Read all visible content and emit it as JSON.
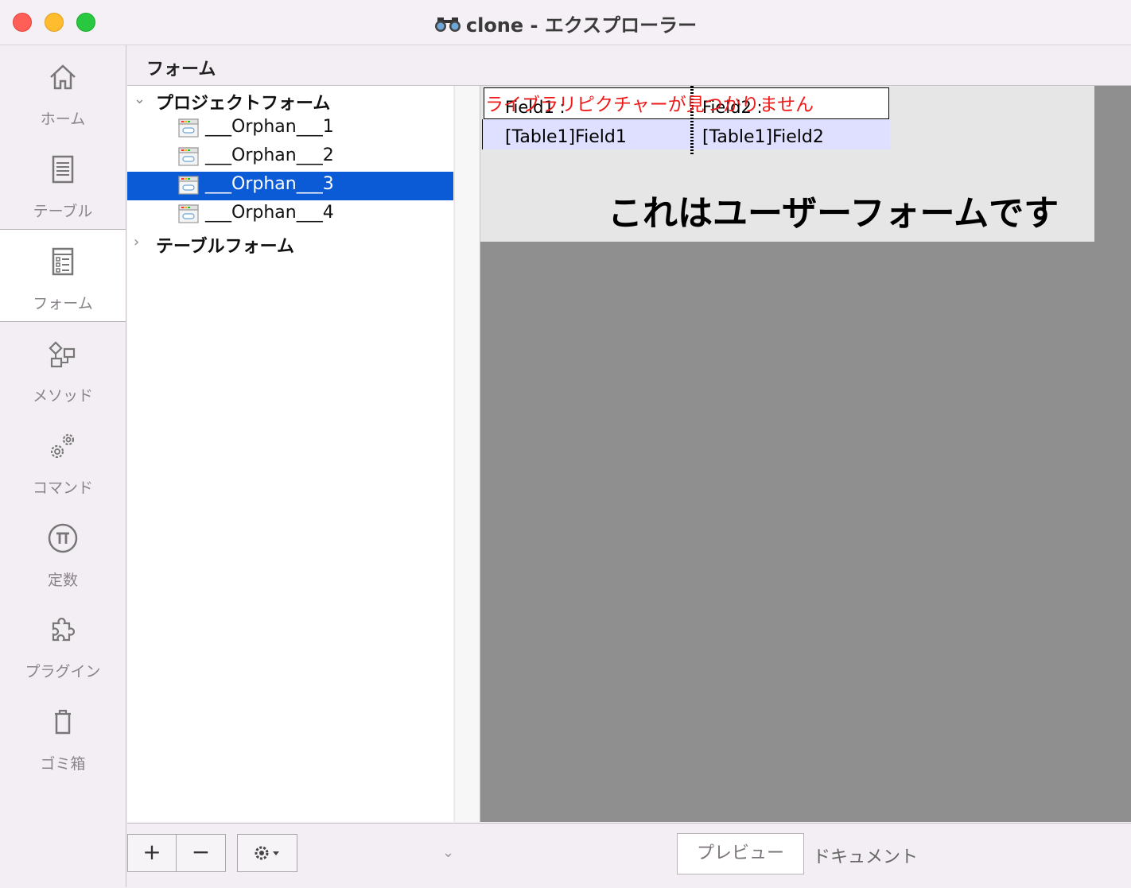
{
  "window": {
    "title": "clone - エクスプローラー"
  },
  "sidebar": {
    "items": [
      {
        "label": "ホーム",
        "icon": "home-icon"
      },
      {
        "label": "テーブル",
        "icon": "table-icon"
      },
      {
        "label": "フォーム",
        "icon": "form-icon",
        "active": true
      },
      {
        "label": "メソッド",
        "icon": "method-icon"
      },
      {
        "label": "コマンド",
        "icon": "gears-icon"
      },
      {
        "label": "定数",
        "icon": "pi-icon"
      },
      {
        "label": "プラグイン",
        "icon": "puzzle-icon"
      },
      {
        "label": "ゴミ箱",
        "icon": "trash-icon"
      }
    ]
  },
  "header": {
    "title": "フォーム"
  },
  "tree": {
    "project_group": "プロジェクトフォーム",
    "forms": [
      "___Orphan___1",
      "___Orphan___2",
      "___Orphan___3",
      "___Orphan___4"
    ],
    "selected_index": 2,
    "table_group": "テーブルフォーム"
  },
  "preview": {
    "error_text": "ライブラリピクチャーが見つかりません",
    "header_field1": "Field1 :",
    "header_field2": "Field2 :",
    "data_field1": "[Table1]Field1",
    "data_field2": "[Table1]Field2",
    "caption": "これはユーザーフォームです"
  },
  "bottom": {
    "add_label": "+",
    "remove_label": "−",
    "preview_button": "プレビュー",
    "document_label": "ドキュメント"
  },
  "colors": {
    "selection": "#0b5ad6",
    "error": "#ee1a1a",
    "preview_bg": "#8f8f8f"
  }
}
